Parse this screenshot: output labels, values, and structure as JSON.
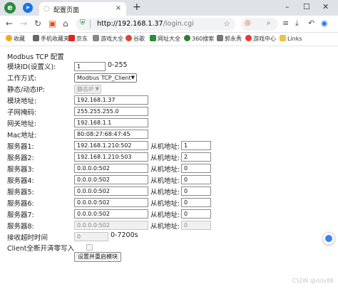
{
  "browser": {
    "tab_title": "配置页面",
    "tab_close": "×",
    "new_tab": "+",
    "window_controls": {
      "minimize": "–",
      "maximize": "☐",
      "close": "✕"
    },
    "url_host": "http://192.168.1.37",
    "url_path": "/login.cgi",
    "bookmarks": [
      {
        "label": "收藏",
        "icon": "star-icon",
        "color": "#f5a623"
      },
      {
        "label": "手机收藏夹",
        "icon": "phone-icon",
        "color": "#666666"
      },
      {
        "label": "京东",
        "icon": "jd-icon",
        "color": "#e1251b"
      },
      {
        "label": "游戏大全",
        "icon": "game-icon",
        "color": "#888888"
      },
      {
        "label": "谷歌",
        "icon": "google-icon",
        "color": "#db4437"
      },
      {
        "label": "网址大全",
        "icon": "sites-icon",
        "color": "#2e8b3d"
      },
      {
        "label": "360搜索",
        "icon": "360-icon",
        "color": "#2e7d32"
      },
      {
        "label": "郭永秀",
        "icon": "user-icon",
        "color": "#777777"
      },
      {
        "label": "游戏中心",
        "icon": "game-center-icon",
        "color": "#e53935"
      },
      {
        "label": "Links",
        "icon": "folder-icon",
        "color": "#f0c04a"
      }
    ]
  },
  "form": {
    "title": "Modbus TCP 配置",
    "module_id": {
      "label": "模块ID(设置义):",
      "value": "1",
      "range": "0-255"
    },
    "work_mode": {
      "label": "工作方式:",
      "value": "Modbus TCP_Client"
    },
    "static_dynamic_ip": {
      "label": "静态/动态IP:",
      "value": "静态IP"
    },
    "module_address": {
      "label": "模块地址:",
      "value": "192.168.1.37"
    },
    "subnet_mask": {
      "label": "子网掩码:",
      "value": "255.255.255.0"
    },
    "gateway": {
      "label": "网关地址:",
      "value": "192.168.1.1"
    },
    "mac": {
      "label": "Mac地址:",
      "value": "80:08:27:68:47:45"
    },
    "slave_label": "从机地址:",
    "servers": [
      {
        "label": "服务器1:",
        "address": "192.168.1.210:502",
        "slave": "1"
      },
      {
        "label": "服务器2:",
        "address": "192.168.1.210:503",
        "slave": "2"
      },
      {
        "label": "服务器3:",
        "address": "0.0.0.0:502",
        "slave": "0"
      },
      {
        "label": "服务器4:",
        "address": "0.0.0.0:502",
        "slave": "0"
      },
      {
        "label": "服务器5:",
        "address": "0.0.0.0:502",
        "slave": "0"
      },
      {
        "label": "服务器6:",
        "address": "0.0.0.0:502",
        "slave": "0"
      },
      {
        "label": "服务器7:",
        "address": "0.0.0.0:502",
        "slave": "0"
      },
      {
        "label": "服务器8:",
        "address": "0.0.0.0:502",
        "slave": "0"
      }
    ],
    "receive_timeout": {
      "label": "接收超时时间",
      "value": "0",
      "range": "0-7200s"
    },
    "client_clear": {
      "label": "Client全断开清零写入"
    },
    "submit_label": "设置并重启模块"
  },
  "watermark": "CSDN @ddy88"
}
